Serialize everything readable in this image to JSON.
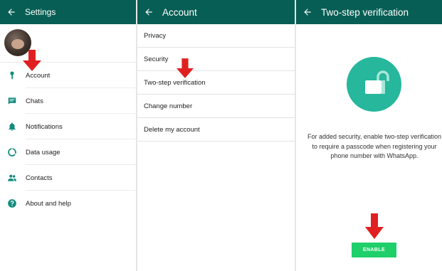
{
  "colors": {
    "appbar": "#075e54",
    "icon_teal": "#128c7e",
    "lock_circle": "#26b79c",
    "enable_button": "#1fcf6a",
    "arrow": "#e02020"
  },
  "settings": {
    "title": "Settings",
    "profile_status": "..",
    "items": [
      {
        "label": "Account",
        "icon": "key-icon"
      },
      {
        "label": "Chats",
        "icon": "chat-icon"
      },
      {
        "label": "Notifications",
        "icon": "bell-icon"
      },
      {
        "label": "Data usage",
        "icon": "data-usage-icon"
      },
      {
        "label": "Contacts",
        "icon": "contacts-icon"
      },
      {
        "label": "About and help",
        "icon": "help-icon"
      }
    ]
  },
  "account": {
    "title": "Account",
    "items": [
      {
        "label": "Privacy"
      },
      {
        "label": "Security"
      },
      {
        "label": "Two-step verification"
      },
      {
        "label": "Change number"
      },
      {
        "label": "Delete my account"
      }
    ]
  },
  "two_step": {
    "title": "Two-step verification",
    "description": "For added security, enable two-step verification to require a passcode when registering your phone number with WhatsApp.",
    "enable_label": "ENABLE"
  }
}
